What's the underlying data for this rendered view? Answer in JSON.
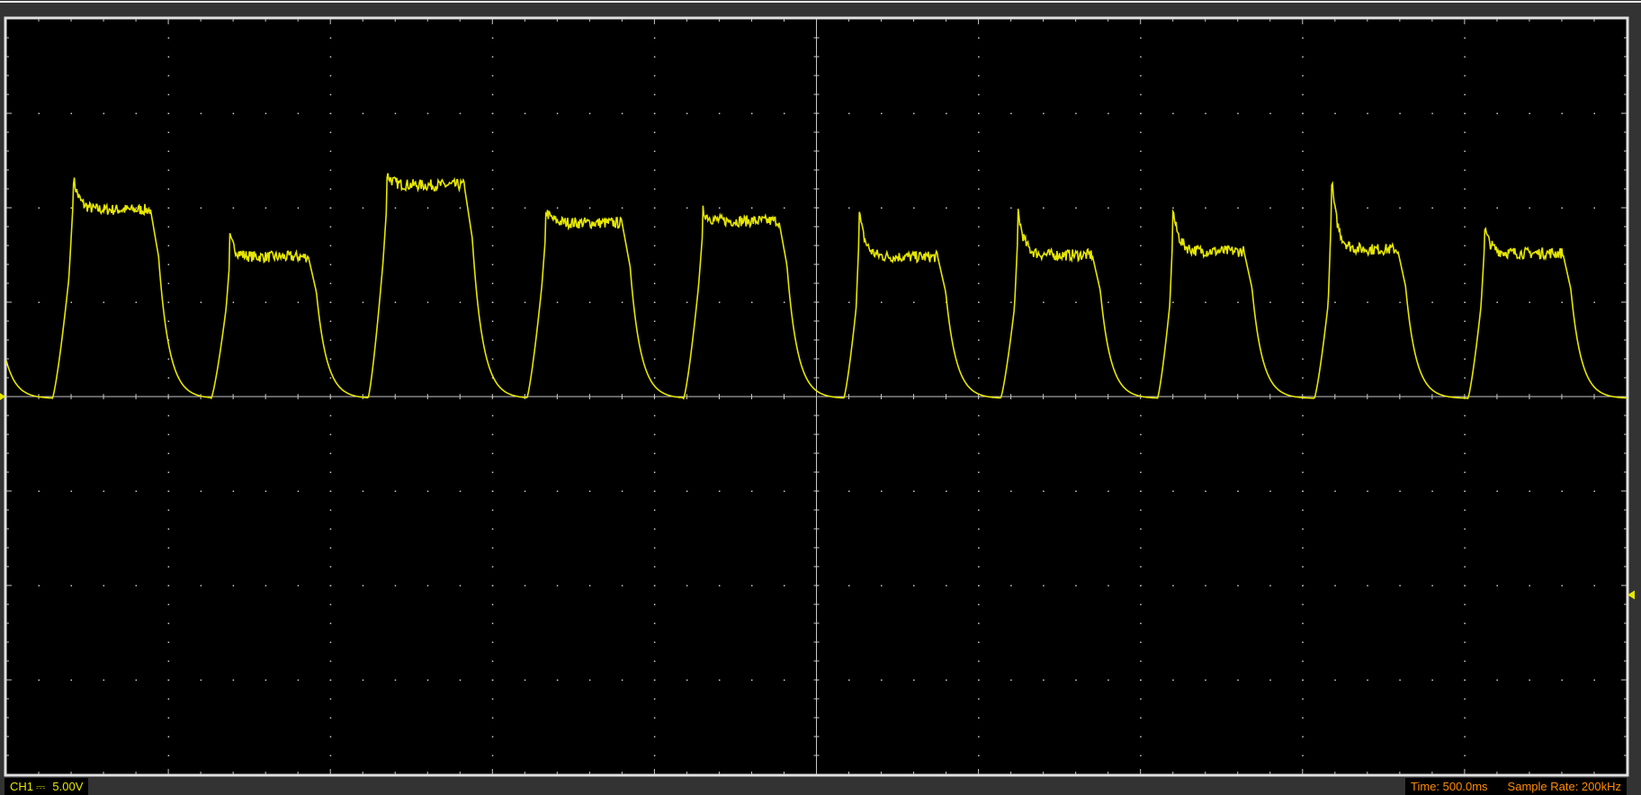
{
  "status": {
    "channel": "CH1",
    "coupling_icon": "dc-coupling-icon",
    "volts_per_div": "5.00V",
    "time": "Time: 500.0ms",
    "sample_rate": "Sample Rate: 200kHz"
  },
  "colors": {
    "trace": "#e6e600",
    "grid": "#c8c8c8",
    "background": "#000000",
    "info_text": "#ff8c00"
  },
  "chart_data": {
    "type": "line",
    "title": "",
    "xlabel": "",
    "ylabel": "",
    "x_units": "ms",
    "y_units": "V",
    "xlim": [
      -2500,
      2500
    ],
    "ylim": [
      -20,
      20
    ],
    "x_div": 500,
    "y_div": 5,
    "grid": true,
    "ground_marker_v": 0,
    "trigger_marker_v": -10.5,
    "series": [
      {
        "baseline_v": -0.1,
        "pulses": [
          {
            "rise_start": -2358,
            "top": -2294,
            "fall": -2055,
            "plateau_v": 9.9,
            "peak_v": 11.7
          },
          {
            "rise_start": -1868,
            "top": -1810,
            "fall": -1568,
            "plateau_v": 7.4,
            "peak_v": 8.4
          },
          {
            "rise_start": -1384,
            "top": -1326,
            "fall": -1087,
            "plateau_v": 11.2,
            "peak_v": 11.8
          },
          {
            "rise_start": -894,
            "top": -836,
            "fall": -600,
            "plateau_v": 9.2,
            "peak_v": 9.9
          },
          {
            "rise_start": -410,
            "top": -352,
            "fall": -116,
            "plateau_v": 9.3,
            "peak_v": 9.9
          },
          {
            "rise_start": 84,
            "top": 132,
            "fall": 374,
            "plateau_v": 7.4,
            "peak_v": 9.8
          },
          {
            "rise_start": 568,
            "top": 622,
            "fall": 851,
            "plateau_v": 7.5,
            "peak_v": 9.9
          },
          {
            "rise_start": 1052,
            "top": 1100,
            "fall": 1319,
            "plateau_v": 7.7,
            "peak_v": 9.9
          },
          {
            "rise_start": 1536,
            "top": 1590,
            "fall": 1793,
            "plateau_v": 7.8,
            "peak_v": 11.5
          },
          {
            "rise_start": 2010,
            "top": 2061,
            "fall": 2303,
            "plateau_v": 7.6,
            "peak_v": 9.0
          }
        ]
      }
    ]
  }
}
